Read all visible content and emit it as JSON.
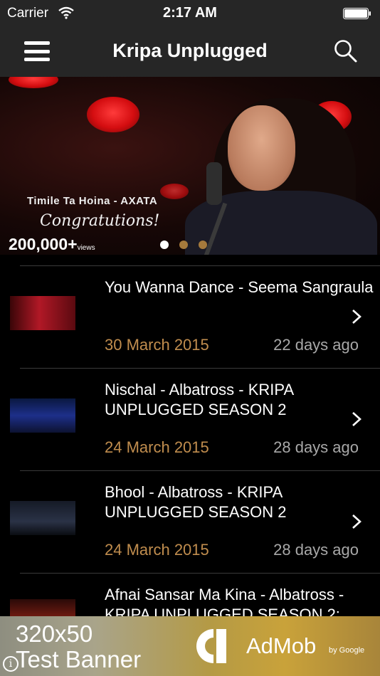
{
  "status_bar": {
    "carrier": "Carrier",
    "time": "2:17 AM"
  },
  "nav": {
    "title": "Kripa Unplugged",
    "menu_icon": "hamburger-menu-icon",
    "search_icon": "search-icon"
  },
  "hero": {
    "caption_line1": "Timile Ta Hoina - AXATA",
    "caption_line2": "Congratutions!",
    "views_count": "200,000+",
    "views_unit": "views",
    "page_count": 3,
    "current_page": 1
  },
  "videos": [
    {
      "title": "You Wanna Dance - Seema Sangraula",
      "date": "30 March 2015",
      "ago": "22 days ago"
    },
    {
      "title": "Nischal - Albatross - KRIPA UNPLUGGED SEASON 2",
      "date": "24 March 2015",
      "ago": "28 days ago"
    },
    {
      "title": "Bhool - Albatross - KRIPA UNPLUGGED SEASON 2",
      "date": "24 March 2015",
      "ago": "28 days ago"
    },
    {
      "title": "Afnai Sansar Ma  Kina - Albatross - KRIPA UNPLUGGED SEASON 2:",
      "date": "",
      "ago": ""
    }
  ],
  "ad": {
    "size": "320x50",
    "label": "Test Banner",
    "brand": "AdMob",
    "by": "by Google"
  },
  "colors": {
    "bar_background": "#262626",
    "date_color": "#c08d4e",
    "ago_color": "#a8a8a8"
  }
}
